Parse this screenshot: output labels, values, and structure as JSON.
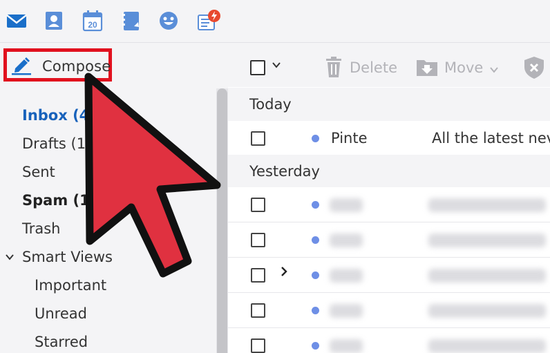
{
  "app_icons": [
    "mail-icon",
    "contacts-icon",
    "calendar-icon",
    "notepad-icon",
    "messenger-icon",
    "news-icon"
  ],
  "calendar_day": "20",
  "compose": {
    "label": "Compose"
  },
  "sidebar": {
    "folders": [
      {
        "label": "Inbox (43"
      },
      {
        "label": "Drafts (14"
      },
      {
        "label": "Sent"
      },
      {
        "label": "Spam (14"
      },
      {
        "label": "Trash"
      },
      {
        "label": "Smart Views"
      },
      {
        "label": "Important"
      },
      {
        "label": "Unread"
      },
      {
        "label": "Starred"
      }
    ]
  },
  "toolbar": {
    "delete_label": "Delete",
    "move_label": "Move"
  },
  "list": {
    "today_label": "Today",
    "yesterday_label": "Yesterday",
    "today_row": {
      "sender": "Pinte",
      "subject": "All the latest nev"
    }
  },
  "colors": {
    "accent": "#1862bb",
    "highlight_red": "#e1101e",
    "arrow_red": "#e03140",
    "unread_dot": "#6e8fe6",
    "news_badge": "#e8492f"
  }
}
